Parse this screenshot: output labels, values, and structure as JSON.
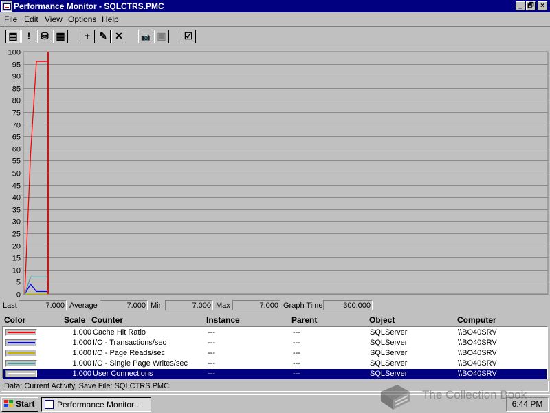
{
  "window": {
    "title": "Performance Monitor - SQLCTRS.PMC",
    "controls": [
      "_",
      "🗗",
      "×"
    ]
  },
  "menu": [
    {
      "label": "File",
      "key": "F",
      "rest": "ile"
    },
    {
      "label": "Edit",
      "key": "E",
      "rest": "dit"
    },
    {
      "label": "View",
      "key": "V",
      "rest": "iew"
    },
    {
      "label": "Options",
      "key": "O",
      "rest": "ptions"
    },
    {
      "label": "Help",
      "key": "H",
      "rest": "elp"
    }
  ],
  "toolbar": [
    {
      "icon": "chart-view-icon",
      "glyph": "▤",
      "state": "pressed"
    },
    {
      "icon": "alert-view-icon",
      "glyph": "!",
      "state": "normal"
    },
    {
      "icon": "log-view-icon",
      "glyph": "⛁",
      "state": "normal"
    },
    {
      "icon": "report-view-icon",
      "glyph": "▦",
      "state": "normal"
    },
    {
      "icon": "add-counter-icon",
      "glyph": "+",
      "state": "normal"
    },
    {
      "icon": "edit-counter-icon",
      "glyph": "✎",
      "state": "normal"
    },
    {
      "icon": "delete-counter-icon",
      "glyph": "✕",
      "state": "normal"
    },
    {
      "icon": "update-now-icon",
      "glyph": "📷",
      "state": "normal"
    },
    {
      "icon": "bookmark-icon",
      "glyph": "▣",
      "state": "disabled"
    },
    {
      "icon": "options-icon",
      "glyph": "☑",
      "state": "normal"
    }
  ],
  "chart_data": {
    "type": "line",
    "ylim": [
      0,
      100
    ],
    "y_ticks": [
      0,
      5,
      10,
      15,
      20,
      25,
      30,
      35,
      40,
      45,
      50,
      55,
      60,
      65,
      70,
      75,
      80,
      85,
      90,
      95,
      100
    ],
    "time_window_seconds": 300,
    "current_marker_index": 4,
    "grid": true,
    "series": [
      {
        "name": "Cache Hit Ratio",
        "color": "#ff0000",
        "values": [
          0,
          58,
          96,
          96,
          96
        ]
      },
      {
        "name": "I/O - Transactions/sec",
        "color": "#0000ff",
        "values": [
          0,
          4,
          1,
          1,
          1
        ]
      },
      {
        "name": "I/O - Page Reads/sec",
        "color": "#c8b400",
        "values": [
          0,
          0,
          0,
          0,
          0
        ]
      },
      {
        "name": "I/O - Single Page Writes/sec",
        "color": "#40a0a0",
        "values": [
          0,
          7,
          7,
          7,
          7
        ]
      },
      {
        "name": "User Connections",
        "color": "#ffffff",
        "values": [
          0,
          7,
          7,
          7,
          7
        ]
      }
    ]
  },
  "valuebar": {
    "last_label": "Last",
    "last": "7.000",
    "average_label": "Average",
    "average": "7.000",
    "min_label": "Min",
    "min": "7.000",
    "max_label": "Max",
    "max": "7.000",
    "graph_time_label": "Graph Time",
    "graph_time": "300.000"
  },
  "legend": {
    "headers": [
      "Color",
      "Scale",
      "Counter",
      "Instance",
      "Parent",
      "Object",
      "Computer"
    ],
    "rows": [
      {
        "color": "#ff0000",
        "scale": "1.000",
        "counter": "Cache Hit Ratio",
        "instance": "---",
        "parent": "---",
        "object": "SQLServer",
        "computer": "\\\\BO40SRV",
        "selected": false
      },
      {
        "color": "#0000ff",
        "scale": "1.000",
        "counter": "I/O - Transactions/sec",
        "instance": "---",
        "parent": "---",
        "object": "SQLServer",
        "computer": "\\\\BO40SRV",
        "selected": false
      },
      {
        "color": "#c8b400",
        "scale": "1.000",
        "counter": "I/O - Page Reads/sec",
        "instance": "---",
        "parent": "---",
        "object": "SQLServer",
        "computer": "\\\\BO40SRV",
        "selected": false
      },
      {
        "color": "#40a0a0",
        "scale": "1.000",
        "counter": "I/O - Single Page Writes/sec",
        "instance": "---",
        "parent": "---",
        "object": "SQLServer",
        "computer": "\\\\BO40SRV",
        "selected": false
      },
      {
        "color": "#ffffff",
        "scale": "1.000",
        "counter": "User Connections",
        "instance": "---",
        "parent": "---",
        "object": "SQLServer",
        "computer": "\\\\BO40SRV",
        "selected": true
      }
    ]
  },
  "statusbar": {
    "text": "Data: Current Activity, Save File: SQLCTRS.PMC"
  },
  "taskbar": {
    "start_label": "Start",
    "task_label": "Performance Monitor ...",
    "clock": "6:44 PM"
  },
  "watermark": {
    "text": "The Collection Book"
  }
}
